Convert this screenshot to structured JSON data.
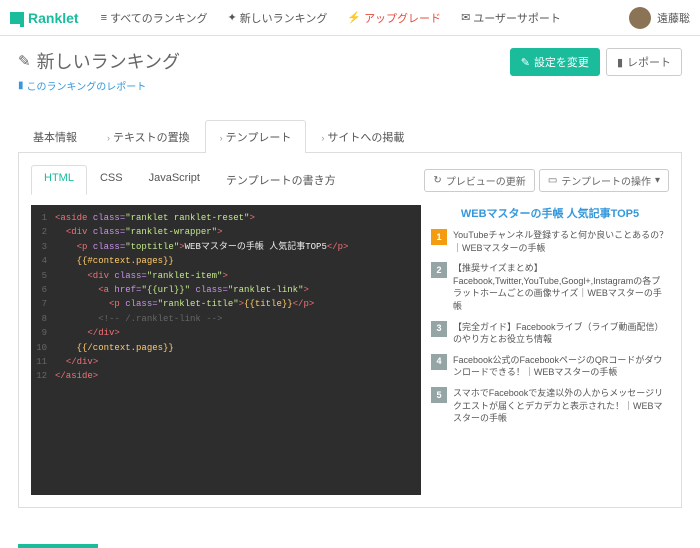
{
  "nav": {
    "brand": "Ranklet",
    "links": {
      "all": "すべてのランキング",
      "new": "新しいランキング",
      "upgrade": "アップグレード",
      "support": "ユーザーサポート"
    },
    "username": "遠藤聡"
  },
  "header": {
    "title": "新しいランキング",
    "subtitle": "このランキングのレポート",
    "btn_settings": "設定を変更",
    "btn_report": "レポート"
  },
  "tabs_outer": {
    "basic": "基本情報",
    "text": "テキストの置換",
    "template": "テンプレート",
    "embed": "サイトへの掲載"
  },
  "tabs_inner": {
    "html": "HTML",
    "css": "CSS",
    "js": "JavaScript",
    "howto": "テンプレートの書き方"
  },
  "toolbar": {
    "preview_update": "プレビューの更新",
    "template_ops": "テンプレートの操作"
  },
  "code": {
    "l1": {
      "a": "<aside ",
      "b": "class=",
      "c": "\"ranklet ranklet-reset\"",
      "d": ">"
    },
    "l2": {
      "a": "<div ",
      "b": "class=",
      "c": "\"ranklet-wrapper\"",
      "d": ">"
    },
    "l3": {
      "a": "<p ",
      "b": "class=",
      "c": "\"toptitle\"",
      "d": ">",
      "e": "WEBマスターの手帳 人気記事TOP5",
      "f": "</p>"
    },
    "l4": {
      "a": "{{#context.pages}}"
    },
    "l5": {
      "a": "<div ",
      "b": "class=",
      "c": "\"ranklet-item\"",
      "d": ">"
    },
    "l6": {
      "a": "<a ",
      "b": "href=",
      "c": "\"{{url}}\"",
      "d": " class=",
      "e": "\"ranklet-link\"",
      "f": ">"
    },
    "l7": {
      "a": "<p ",
      "b": "class=",
      "c": "\"ranklet-title\"",
      "d": ">",
      "e": "{{title}}",
      "f": "</p>"
    },
    "l8": {
      "a": "<!-- /.ranklet-link -->"
    },
    "l9": {
      "a": "</div>"
    },
    "l10": {
      "a": "{{/context.pages}}"
    },
    "l11": {
      "a": "</div>"
    },
    "l12": {
      "a": "</aside>"
    }
  },
  "preview": {
    "title": "WEBマスターの手帳 人気記事TOP5",
    "items": {
      "1": "YouTubeチャンネル登録すると何か良いことあるの？｜WEBマスターの手帳",
      "2": "【推奨サイズまとめ】Facebook,Twitter,YouTube,Googl+,Instagramの各プラットホームごとの画像サイズ｜WEBマスターの手帳",
      "3": "【完全ガイド】Facebookライブ（ライブ動画配信）のやり方とお役立ち情報",
      "4": "Facebook公式のFacebookページのQRコードがダウンロードできる！｜WEBマスターの手帳",
      "5": "スマホでFacebookで友達以外の人からメッセージリクエストが届くとデカデカと表示された！｜WEBマスターの手帳"
    }
  }
}
